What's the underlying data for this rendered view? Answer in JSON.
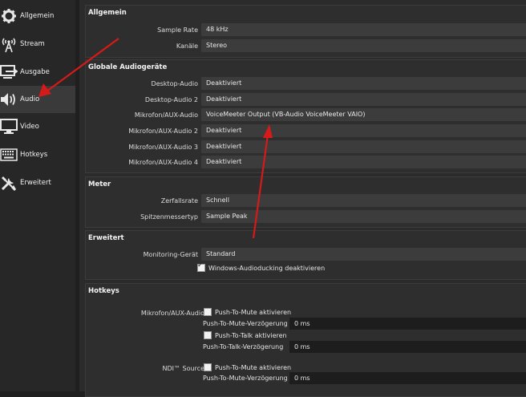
{
  "sidebar": {
    "items": [
      {
        "label": "Allgemein",
        "icon": "gear-icon"
      },
      {
        "label": "Stream",
        "icon": "antenna-icon"
      },
      {
        "label": "Ausgabe",
        "icon": "output-icon"
      },
      {
        "label": "Audio",
        "icon": "speaker-icon"
      },
      {
        "label": "Video",
        "icon": "monitor-icon"
      },
      {
        "label": "Hotkeys",
        "icon": "keyboard-icon"
      },
      {
        "label": "Erweitert",
        "icon": "tools-icon"
      }
    ],
    "active": "Audio"
  },
  "allgemein": {
    "title": "Allgemein",
    "sample_rate_label": "Sample Rate",
    "sample_rate_value": "48 kHz",
    "channels_label": "Kanäle",
    "channels_value": "Stereo"
  },
  "devices": {
    "title": "Globale Audiogeräte",
    "rows": [
      {
        "label": "Desktop-Audio",
        "value": "Deaktiviert"
      },
      {
        "label": "Desktop-Audio 2",
        "value": "Deaktiviert"
      },
      {
        "label": "Mikrofon/AUX-Audio",
        "value": "VoiceMeeter Output (VB-Audio VoiceMeeter VAIO)"
      },
      {
        "label": "Mikrofon/AUX-Audio 2",
        "value": "Deaktiviert"
      },
      {
        "label": "Mikrofon/AUX-Audio 3",
        "value": "Deaktiviert"
      },
      {
        "label": "Mikrofon/AUX-Audio 4",
        "value": "Deaktiviert"
      }
    ]
  },
  "meter": {
    "title": "Meter",
    "decay_label": "Zerfallsrate",
    "decay_value": "Schnell",
    "peak_label": "Spitzenmessertyp",
    "peak_value": "Sample Peak"
  },
  "advanced": {
    "title": "Erweitert",
    "monitoring_label": "Monitoring-Gerät",
    "monitoring_value": "Standard",
    "ducking_label": "Windows-Audioducking deaktivieren",
    "ducking_checked": true
  },
  "hotkeys": {
    "title": "Hotkeys",
    "mic_label": "Mikrofon/AUX-Audio",
    "ptm_enable": "Push-To-Mute aktivieren",
    "ptm_delay": "Push-To-Mute-Verzögerung",
    "ptm_delay_value": "0 ms",
    "ptt_enable": "Push-To-Talk aktivieren",
    "ptt_delay": "Push-To-Talk-Verzögerung",
    "ptt_delay_value": "0 ms",
    "ndi_label": "NDI™ Source",
    "ndi_ptm_enable": "Push-To-Mute aktivieren",
    "ndi_ptm_delay": "Push-To-Mute-Verzögerung",
    "ndi_ptm_delay_value": "0 ms"
  },
  "colors": {
    "annotation_arrow": "#d61a1a",
    "sidebar_bg": "#272727",
    "content_bg": "#2b2b2b",
    "field_bg": "#3c3c3c"
  }
}
